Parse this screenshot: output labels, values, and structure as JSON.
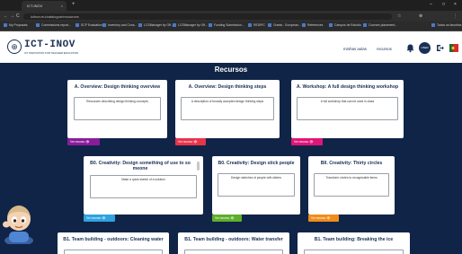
{
  "browser": {
    "tab_title": "ICT-INOV",
    "tab_close": "×",
    "new_tab": "+",
    "window_controls": [
      "–",
      "□",
      "×"
    ],
    "nav_buttons": [
      "←",
      "→",
      "C"
    ],
    "url": "ictinov.eu/catalogue/resources",
    "toolbar_icons": [
      "☆",
      "⊕",
      "⋮"
    ],
    "bookmarks": [
      "My Proposals",
      "Commissions report...",
      "SCP Evaluation",
      "Inventory and Cons...",
      "LCSManager by Gff...",
      "LCSManager by Gff...",
      "Funding Submission...",
      "REDIPC",
      "Grants - European...",
      "References",
      "Campus de Estudio",
      "Courses placement..."
    ],
    "bookmarks_other": "Todos os favoritos"
  },
  "header": {
    "logo_mark": "⊕",
    "logo_text": "ICT-INOV",
    "logo_sub": "ICT INNOVATION FOR TEACHER EDUCATION",
    "links": [
      "minhas aulas",
      "recursos"
    ],
    "user_initials": "USER",
    "icons": {
      "bell": "bell-icon",
      "logout": "logout-icon",
      "flag": "flag-icon"
    }
  },
  "main": {
    "title": "Recursos",
    "cards": [
      {
        "title": "A. Overview: Design thinking overview",
        "desc": "Resources describing design thinking concepts",
        "button": "Ver recurso",
        "color": "#8a1c9b"
      },
      {
        "title": "A. Overview: Design thinking steps",
        "desc": "A description of broadly accepted design thinking steps",
        "button": "Ver recurso",
        "color": "#e8344b"
      },
      {
        "title": "A. Workshop: A full design thinking workshop",
        "desc": "A full workshop that can be used in class",
        "button": "Ver recurso",
        "color": "#e0157a"
      },
      {
        "title": "B0. Creativity: Design something of use to so meone",
        "desc": "Make a quick sketch of a solution",
        "button": "Ver recurso",
        "color": "#2fa3e0"
      },
      {
        "title": "B0. Creativity: Design stick people",
        "desc": "Design sketches of people with sliders",
        "button": "Ver recurso",
        "color": "#5fae2e"
      },
      {
        "title": "BII. Creativity: Thirty circles",
        "desc": "Transform circles to recognizable items",
        "button": "Ver recurso",
        "color": "#f08c1a"
      },
      {
        "title": "B1. Team building - outdoors: Cleaning water",
        "desc": "",
        "button": "",
        "color": ""
      },
      {
        "title": "B1. Team building - outdoors: Water transfer",
        "desc": "",
        "button": "",
        "color": ""
      },
      {
        "title": "B1. Team building: Breaking the ice",
        "desc": "",
        "button": "",
        "color": ""
      }
    ]
  }
}
